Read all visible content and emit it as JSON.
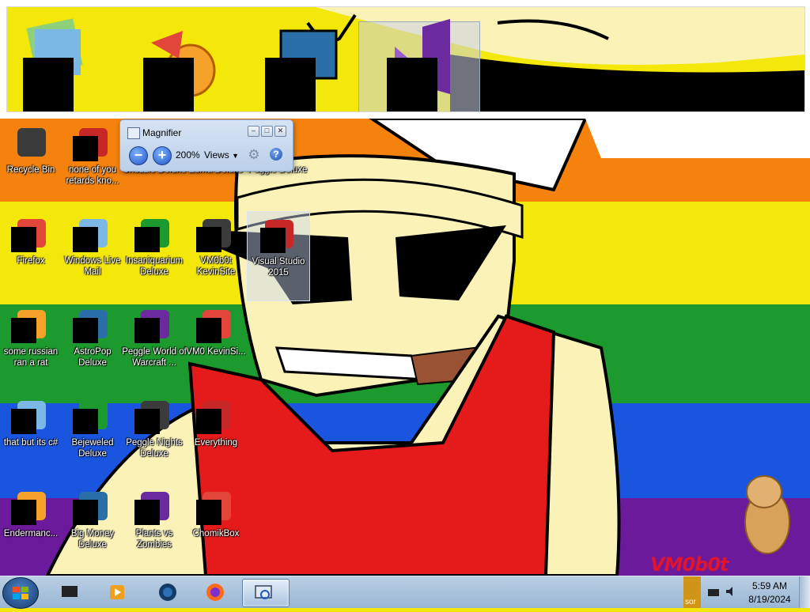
{
  "magnifier_window": {
    "title": "Magnifier",
    "zoom": "200%",
    "views_label": "Views",
    "zoom_out_glyph": "−",
    "zoom_in_glyph": "+",
    "help_glyph": "?"
  },
  "desktop_icons": [
    {
      "label": "Recycle Bin",
      "icon": "recycle-bin-icon"
    },
    {
      "label": "none of you retards kno...",
      "icon": "app-icon"
    },
    {
      "label": "Chuzzle Deluxe",
      "icon": "game-icon"
    },
    {
      "label": "Zuma Deluxe",
      "icon": "game-icon"
    },
    {
      "label": "Peggle Deluxe",
      "icon": "game-icon"
    },
    {
      "label": "Firefox",
      "icon": "firefox-icon"
    },
    {
      "label": "Windows Live Mail",
      "icon": "mail-icon"
    },
    {
      "label": "Insaniquarium Deluxe",
      "icon": "fish-icon"
    },
    {
      "label": "VM0b0t KevinSite",
      "icon": "shortcut-icon"
    },
    {
      "label": "Visual Studio 2015",
      "icon": "visual-studio-icon"
    },
    {
      "label": "some russian ran a rat",
      "icon": "file-icon"
    },
    {
      "label": "AstroPop Deluxe",
      "icon": "game-icon"
    },
    {
      "label": "Peggle World of Warcraft ...",
      "icon": "game-icon"
    },
    {
      "label": "VM0 KevinSi...",
      "icon": "shortcut-icon"
    },
    {
      "label": "that but its c#",
      "icon": "folder-icon"
    },
    {
      "label": "Bejeweled Deluxe",
      "icon": "gem-icon"
    },
    {
      "label": "Peggle Nights Deluxe",
      "icon": "game-icon"
    },
    {
      "label": "Everything",
      "icon": "search-app-icon"
    },
    {
      "label": "Endermanc...",
      "icon": "terminal-icon"
    },
    {
      "label": "Big Money Deluxe",
      "icon": "money-bag-icon"
    },
    {
      "label": "Plants vs Zombies",
      "icon": "plant-icon"
    },
    {
      "label": "ChomikBox",
      "icon": "hamster-icon"
    }
  ],
  "taskbar": {
    "start": "start-orb-icon",
    "pinned": [
      "monitor-icon",
      "media-player-icon",
      "globe-icon",
      "firefox-icon",
      "magnifier-icon"
    ],
    "tray_notification": "sor",
    "clock_time": "5:59 AM",
    "clock_date": "8/19/2024"
  },
  "wallpaper": {
    "stripe_colors": [
      "#f5820d",
      "#f4e70a",
      "#1d9a2e",
      "#1a55e0",
      "#6a1a9a"
    ],
    "watermark": "VM0b0t"
  },
  "colors": {
    "taskbar": "#9ab6d3",
    "accent": "#1f56c4"
  }
}
